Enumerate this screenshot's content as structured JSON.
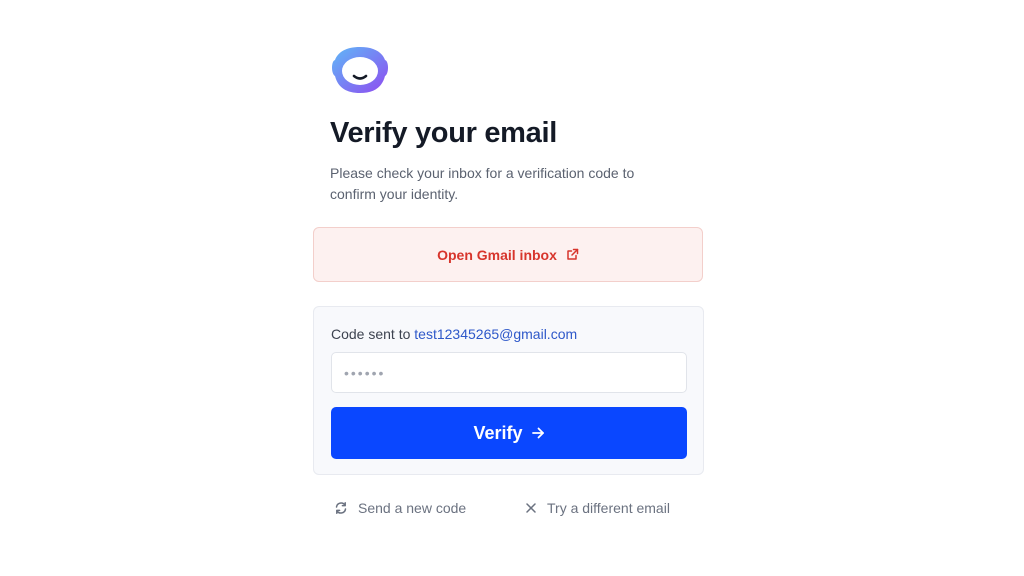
{
  "header": {
    "title": "Verify your email",
    "subtitle": "Please check your inbox for a verification code to confirm your identity."
  },
  "gmail_button": {
    "label": "Open Gmail inbox",
    "icon": "external-link-icon",
    "color": "#d7352c",
    "background": "#fdf1f0"
  },
  "verification": {
    "code_sent_label": "Code sent to",
    "email": "test12345265@gmail.com",
    "input_placeholder": "••••••",
    "input_value": "",
    "verify_label": "Verify",
    "verify_icon": "arrow-right-icon",
    "verify_color": "#0a47ff"
  },
  "footer_links": {
    "send_new_code": "Send a new code",
    "send_new_code_icon": "refresh-icon",
    "try_different_email": "Try a different email",
    "try_different_email_icon": "close-icon"
  },
  "brand": {
    "logo_icon": "smiling-face-logo-icon",
    "gradient": [
      "#5fb8f7",
      "#8f4bf0"
    ]
  }
}
